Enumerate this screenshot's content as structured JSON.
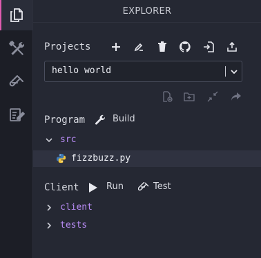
{
  "panel": {
    "title": "EXPLORER"
  },
  "activity_bar": {
    "items": [
      {
        "name": "files-icon",
        "active": true
      },
      {
        "name": "tools-icon",
        "active": false
      },
      {
        "name": "test-tube-icon",
        "active": false
      },
      {
        "name": "notepad-edit-icon",
        "active": false
      }
    ]
  },
  "projects": {
    "title": "Projects",
    "actions": [
      "add-icon",
      "edit-icon",
      "delete-icon",
      "github-icon",
      "import-icon",
      "export-icon"
    ],
    "selected": "hello world",
    "toolbar": [
      "new-file-icon",
      "new-folder-icon",
      "collapse-icon",
      "share-icon"
    ]
  },
  "program": {
    "title": "Program",
    "build_label": "Build",
    "tree": {
      "folder": "src",
      "file": "fizzbuzz.py"
    }
  },
  "client": {
    "title": "Client",
    "run_label": "Run",
    "test_label": "Test",
    "folders": [
      "client",
      "tests"
    ]
  },
  "colors": {
    "accent": "#e05bb0",
    "folder": "#b88cf5",
    "background": "#252833"
  }
}
